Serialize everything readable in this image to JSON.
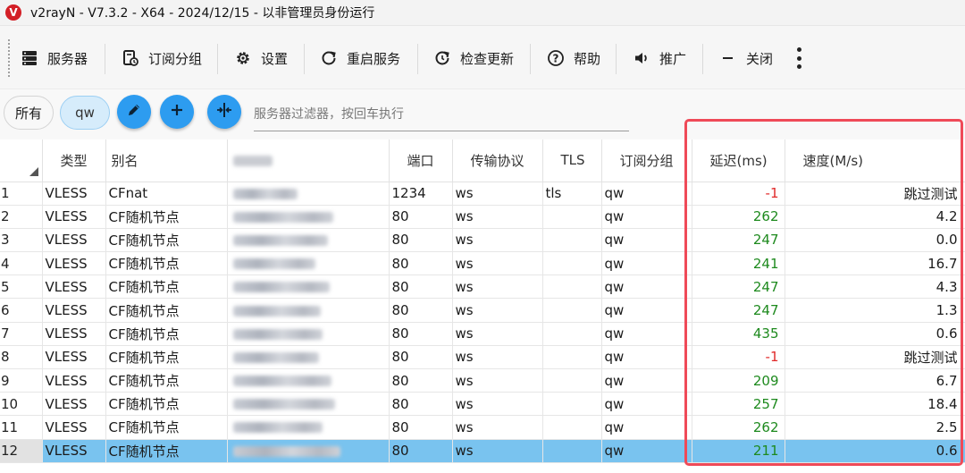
{
  "window": {
    "title": "v2rayN - V7.3.2 - X64 - 2024/12/15 - 以非管理员身份运行",
    "logo_letter": "V"
  },
  "toolbar": {
    "servers": "服务器",
    "subscription_group": "订阅分组",
    "settings": "设置",
    "restart_service": "重启服务",
    "check_update": "检查更新",
    "help": "帮助",
    "promote": "推广",
    "close": "关闭"
  },
  "filter": {
    "chip_all": "所有",
    "chip_qw": "qw",
    "placeholder": "服务器过滤器，按回车执行"
  },
  "table": {
    "columns": {
      "type": "类型",
      "alias": "别名",
      "port": "端口",
      "transport": "传输协议",
      "tls": "TLS",
      "sub_group": "订阅分组",
      "delay": "延迟(ms)",
      "speed": "速度(M/s)"
    },
    "rows": [
      {
        "idx": "1",
        "type": "VLESS",
        "alias": "CFnat",
        "port": "1234",
        "transport": "ws",
        "tls": "tls",
        "group": "qw",
        "delay": "-1",
        "speed": "跳过测试"
      },
      {
        "idx": "2",
        "type": "VLESS",
        "alias": "CF随机节点",
        "port": "80",
        "transport": "ws",
        "tls": "",
        "group": "qw",
        "delay": "262",
        "speed": "4.2"
      },
      {
        "idx": "3",
        "type": "VLESS",
        "alias": "CF随机节点",
        "port": "80",
        "transport": "ws",
        "tls": "",
        "group": "qw",
        "delay": "247",
        "speed": "0.0"
      },
      {
        "idx": "4",
        "type": "VLESS",
        "alias": "CF随机节点",
        "port": "80",
        "transport": "ws",
        "tls": "",
        "group": "qw",
        "delay": "241",
        "speed": "16.7"
      },
      {
        "idx": "5",
        "type": "VLESS",
        "alias": "CF随机节点",
        "port": "80",
        "transport": "ws",
        "tls": "",
        "group": "qw",
        "delay": "247",
        "speed": "4.3"
      },
      {
        "idx": "6",
        "type": "VLESS",
        "alias": "CF随机节点",
        "port": "80",
        "transport": "ws",
        "tls": "",
        "group": "qw",
        "delay": "247",
        "speed": "1.3"
      },
      {
        "idx": "7",
        "type": "VLESS",
        "alias": "CF随机节点",
        "port": "80",
        "transport": "ws",
        "tls": "",
        "group": "qw",
        "delay": "435",
        "speed": "0.6"
      },
      {
        "idx": "8",
        "type": "VLESS",
        "alias": "CF随机节点",
        "port": "80",
        "transport": "ws",
        "tls": "",
        "group": "qw",
        "delay": "-1",
        "speed": "跳过测试"
      },
      {
        "idx": "9",
        "type": "VLESS",
        "alias": "CF随机节点",
        "port": "80",
        "transport": "ws",
        "tls": "",
        "group": "qw",
        "delay": "209",
        "speed": "6.7"
      },
      {
        "idx": "10",
        "type": "VLESS",
        "alias": "CF随机节点",
        "port": "80",
        "transport": "ws",
        "tls": "",
        "group": "qw",
        "delay": "257",
        "speed": "18.4"
      },
      {
        "idx": "11",
        "type": "VLESS",
        "alias": "CF随机节点",
        "port": "80",
        "transport": "ws",
        "tls": "",
        "group": "qw",
        "delay": "262",
        "speed": "2.5"
      },
      {
        "idx": "12",
        "type": "VLESS",
        "alias": "CF随机节点",
        "port": "80",
        "transport": "ws",
        "tls": "",
        "group": "qw",
        "delay": "211",
        "speed": "0.6"
      }
    ],
    "selected_row": "12"
  },
  "colors": {
    "accent": "#2d9cf0",
    "selected_row": "#79c3ef",
    "delay_ok": "#1e8a1e",
    "delay_fail": "#e12a2a",
    "highlight_box": "#ef4a58"
  },
  "icons": {
    "servers": "server-rack-icon",
    "subscription_group": "subscription-icon",
    "settings": "gear-icon",
    "restart_service": "restart-icon",
    "check_update": "update-icon",
    "help": "help-icon",
    "promote": "speaker-icon",
    "close": "minus-icon",
    "more": "more-vertical-icon",
    "edit": "pencil-icon",
    "add": "plus-icon",
    "split": "split-columns-icon"
  }
}
